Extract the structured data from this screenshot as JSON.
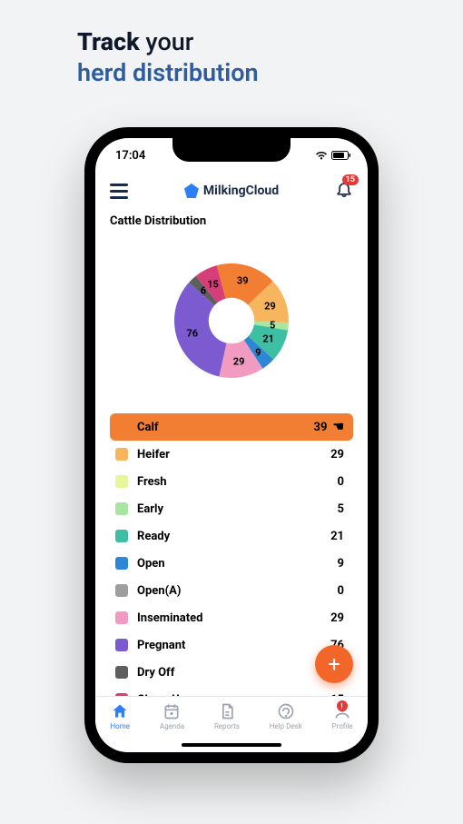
{
  "marketing": {
    "line1_bold": "Track",
    "line1_rest": " your",
    "line2": "herd distribution"
  },
  "status": {
    "time": "17:04"
  },
  "header": {
    "brand": "MilkingCloud",
    "notifications": "15"
  },
  "section_title": "Cattle Distribution",
  "chart_data": {
    "type": "pie",
    "title": "Cattle Distribution",
    "series": [
      {
        "name": "Calf",
        "value": 39,
        "color": "#F27E34"
      },
      {
        "name": "Heifer",
        "value": 29,
        "color": "#F7B55E"
      },
      {
        "name": "Fresh",
        "value": 0,
        "color": "#E7F59B"
      },
      {
        "name": "Early",
        "value": 5,
        "color": "#A8E6A1"
      },
      {
        "name": "Ready",
        "value": 21,
        "color": "#3EBFA3"
      },
      {
        "name": "Open",
        "value": 9,
        "color": "#2D87D6"
      },
      {
        "name": "Open(A)",
        "value": 0,
        "color": "#9E9E9E"
      },
      {
        "name": "Inseminated",
        "value": 29,
        "color": "#F29BC1"
      },
      {
        "name": "Pregnant",
        "value": 76,
        "color": "#7C5BD1"
      },
      {
        "name": "Dry Off",
        "value": 6,
        "color": "#5E5E5E"
      },
      {
        "name": "Close-Up",
        "value": 15,
        "color": "#D63E7A"
      }
    ],
    "selected": "Calf"
  },
  "fab_label": "+",
  "bottom_nav": {
    "items": [
      {
        "label": "Home",
        "active": true
      },
      {
        "label": "Agenda",
        "active": false
      },
      {
        "label": "Reports",
        "active": false
      },
      {
        "label": "Help Desk",
        "active": false
      },
      {
        "label": "Profile",
        "active": false,
        "alert": true
      }
    ]
  }
}
